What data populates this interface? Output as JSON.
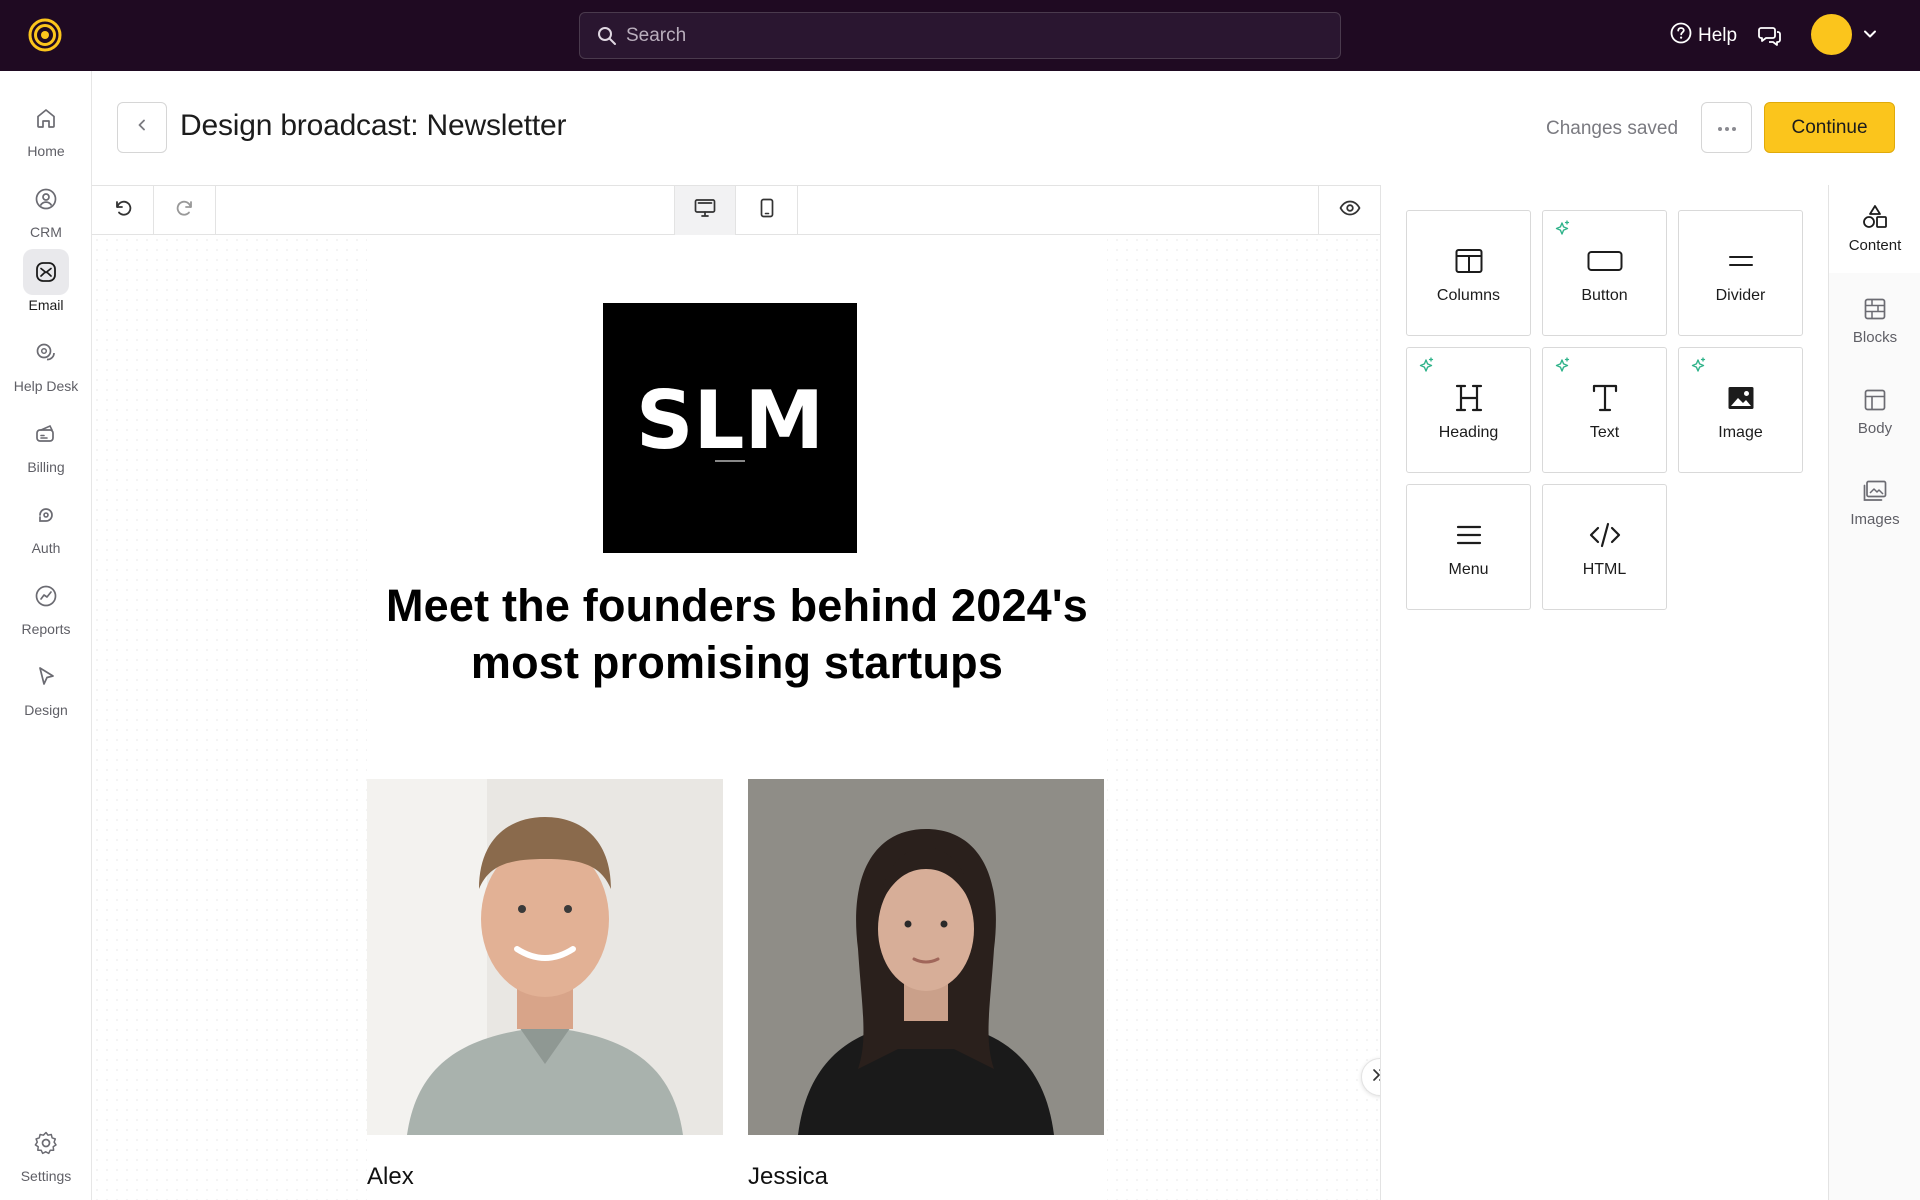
{
  "topbar": {
    "search_placeholder": "Search",
    "help_label": "Help",
    "accent_color": "#fbc51c",
    "bg_color": "#1f0a22"
  },
  "nav": {
    "items": [
      {
        "label": "Home",
        "icon": "home-icon"
      },
      {
        "label": "CRM",
        "icon": "user-circle-icon"
      },
      {
        "label": "Email",
        "icon": "email-icon",
        "active": true
      },
      {
        "label": "Help Desk",
        "icon": "chat-bubbles-icon"
      },
      {
        "label": "Billing",
        "icon": "billing-icon"
      },
      {
        "label": "Auth",
        "icon": "auth-icon"
      },
      {
        "label": "Reports",
        "icon": "reports-icon"
      },
      {
        "label": "Design",
        "icon": "cursor-icon"
      }
    ],
    "settings_label": "Settings"
  },
  "header": {
    "title": "Design broadcast: Newsletter",
    "status": "Changes saved",
    "continue_label": "Continue"
  },
  "email": {
    "logo_text": "SLM",
    "headline": "Meet the founders behind 2024's most promising startups",
    "people": [
      {
        "name": "Alex"
      },
      {
        "name": "Jessica"
      }
    ]
  },
  "panel": {
    "tiles": [
      {
        "label": "Columns",
        "icon": "columns-icon",
        "ai": false
      },
      {
        "label": "Button",
        "icon": "button-icon",
        "ai": true
      },
      {
        "label": "Divider",
        "icon": "divider-icon",
        "ai": false
      },
      {
        "label": "Heading",
        "icon": "heading-icon",
        "ai": true
      },
      {
        "label": "Text",
        "icon": "text-icon",
        "ai": true
      },
      {
        "label": "Image",
        "icon": "image-icon",
        "ai": true
      },
      {
        "label": "Menu",
        "icon": "menu-icon",
        "ai": false
      },
      {
        "label": "HTML",
        "icon": "code-icon",
        "ai": false
      }
    ],
    "tabs": [
      {
        "label": "Content",
        "active": true
      },
      {
        "label": "Blocks"
      },
      {
        "label": "Body"
      },
      {
        "label": "Images"
      }
    ],
    "ai_color": "#2fb38a"
  }
}
